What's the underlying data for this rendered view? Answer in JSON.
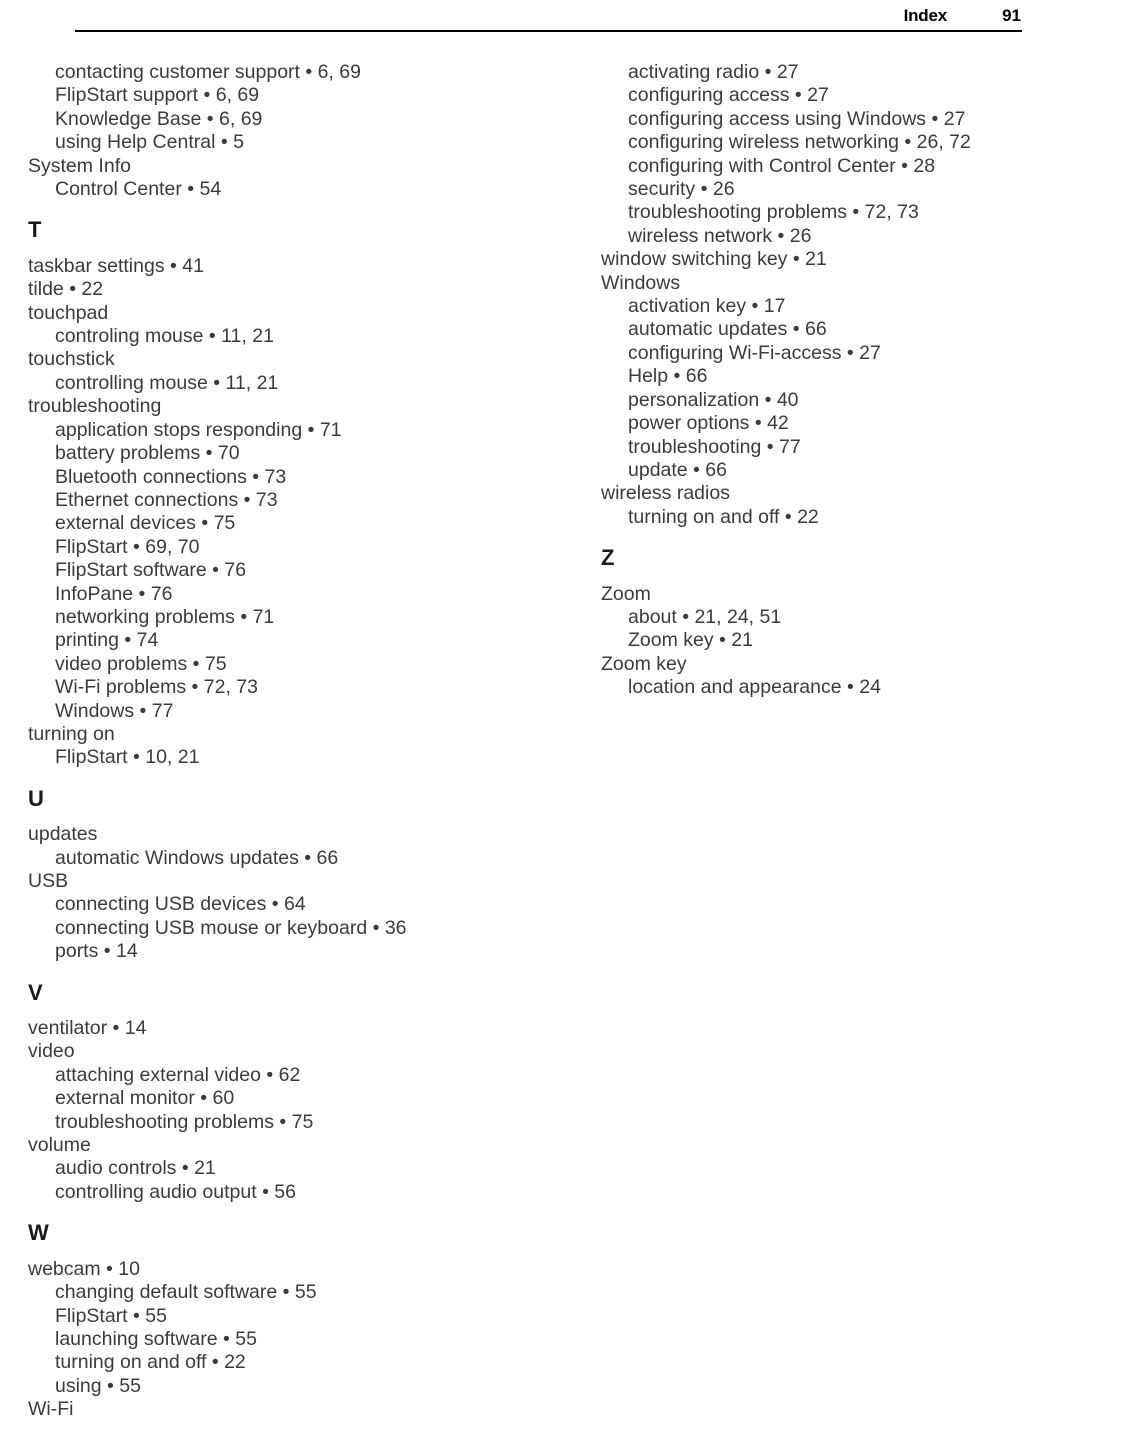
{
  "header": {
    "title": "Index",
    "page_number": "91"
  },
  "columns": [
    {
      "name": "left-column",
      "blocks": [
        {
          "type": "entry",
          "level": 2,
          "text": "contacting customer support • 6, 69"
        },
        {
          "type": "entry",
          "level": 2,
          "text": "FlipStart support • 6, 69"
        },
        {
          "type": "entry",
          "level": 2,
          "text": "Knowledge Base • 6, 69"
        },
        {
          "type": "entry",
          "level": 2,
          "text": "using Help Central • 5"
        },
        {
          "type": "entry",
          "level": 1,
          "text": "System Info"
        },
        {
          "type": "entry",
          "level": 2,
          "text": "Control Center • 54"
        },
        {
          "type": "section",
          "text": "T"
        },
        {
          "type": "entry",
          "level": 1,
          "text": "taskbar settings • 41"
        },
        {
          "type": "entry",
          "level": 1,
          "text": "tilde • 22"
        },
        {
          "type": "entry",
          "level": 1,
          "text": "touchpad"
        },
        {
          "type": "entry",
          "level": 2,
          "text": "controling mouse • 11, 21"
        },
        {
          "type": "entry",
          "level": 1,
          "text": "touchstick"
        },
        {
          "type": "entry",
          "level": 2,
          "text": "controlling mouse • 11, 21"
        },
        {
          "type": "entry",
          "level": 1,
          "text": "troubleshooting"
        },
        {
          "type": "entry",
          "level": 2,
          "text": "application stops responding • 71"
        },
        {
          "type": "entry",
          "level": 2,
          "text": "battery problems • 70"
        },
        {
          "type": "entry",
          "level": 2,
          "text": "Bluetooth connections • 73"
        },
        {
          "type": "entry",
          "level": 2,
          "text": "Ethernet connections • 73"
        },
        {
          "type": "entry",
          "level": 2,
          "text": "external devices • 75"
        },
        {
          "type": "entry",
          "level": 2,
          "text": "FlipStart • 69, 70"
        },
        {
          "type": "entry",
          "level": 2,
          "text": "FlipStart software • 76"
        },
        {
          "type": "entry",
          "level": 2,
          "text": "InfoPane • 76"
        },
        {
          "type": "entry",
          "level": 2,
          "text": "networking problems • 71"
        },
        {
          "type": "entry",
          "level": 2,
          "text": "printing • 74"
        },
        {
          "type": "entry",
          "level": 2,
          "text": "video problems • 75"
        },
        {
          "type": "entry",
          "level": 2,
          "text": "Wi-Fi problems • 72, 73"
        },
        {
          "type": "entry",
          "level": 2,
          "text": "Windows • 77"
        },
        {
          "type": "entry",
          "level": 1,
          "text": "turning on"
        },
        {
          "type": "entry",
          "level": 2,
          "text": "FlipStart • 10, 21"
        },
        {
          "type": "section",
          "text": "U"
        },
        {
          "type": "entry",
          "level": 1,
          "text": "updates"
        },
        {
          "type": "entry",
          "level": 2,
          "text": "automatic Windows updates • 66"
        },
        {
          "type": "entry",
          "level": 1,
          "text": "USB"
        },
        {
          "type": "entry",
          "level": 2,
          "text": "connecting USB devices • 64"
        },
        {
          "type": "entry",
          "level": 2,
          "text": "connecting USB mouse or keyboard • 36"
        },
        {
          "type": "entry",
          "level": 2,
          "text": "ports • 14"
        },
        {
          "type": "section",
          "text": "V"
        },
        {
          "type": "entry",
          "level": 1,
          "text": "ventilator • 14"
        },
        {
          "type": "entry",
          "level": 1,
          "text": "video"
        },
        {
          "type": "entry",
          "level": 2,
          "text": "attaching external video • 62"
        },
        {
          "type": "entry",
          "level": 2,
          "text": "external monitor • 60"
        },
        {
          "type": "entry",
          "level": 2,
          "text": "troubleshooting problems • 75"
        },
        {
          "type": "entry",
          "level": 1,
          "text": "volume"
        },
        {
          "type": "entry",
          "level": 2,
          "text": "audio controls • 21"
        },
        {
          "type": "entry",
          "level": 2,
          "text": "controlling audio output • 56"
        },
        {
          "type": "section",
          "text": "W"
        },
        {
          "type": "entry",
          "level": 1,
          "text": "webcam • 10"
        },
        {
          "type": "entry",
          "level": 2,
          "text": "changing default software • 55"
        },
        {
          "type": "entry",
          "level": 2,
          "text": "FlipStart • 55"
        },
        {
          "type": "entry",
          "level": 2,
          "text": "launching software • 55"
        },
        {
          "type": "entry",
          "level": 2,
          "text": "turning on and off • 22"
        },
        {
          "type": "entry",
          "level": 2,
          "text": "using • 55"
        },
        {
          "type": "entry",
          "level": 1,
          "text": "Wi-Fi"
        }
      ]
    },
    {
      "name": "right-column",
      "blocks": [
        {
          "type": "entry",
          "level": 2,
          "text": "activating radio • 27"
        },
        {
          "type": "entry",
          "level": 2,
          "text": "configuring access • 27"
        },
        {
          "type": "entry",
          "level": 2,
          "text": "configuring access using Windows • 27"
        },
        {
          "type": "entry",
          "level": 2,
          "text": "configuring wireless networking • 26, 72"
        },
        {
          "type": "entry",
          "level": 2,
          "text": "configuring with Control Center • 28"
        },
        {
          "type": "entry",
          "level": 2,
          "text": "security • 26"
        },
        {
          "type": "entry",
          "level": 2,
          "text": "troubleshooting problems • 72, 73"
        },
        {
          "type": "entry",
          "level": 2,
          "text": "wireless network • 26"
        },
        {
          "type": "entry",
          "level": 1,
          "text": "window switching key • 21"
        },
        {
          "type": "entry",
          "level": 1,
          "text": "Windows"
        },
        {
          "type": "entry",
          "level": 2,
          "text": "activation key • 17"
        },
        {
          "type": "entry",
          "level": 2,
          "text": "automatic updates • 66"
        },
        {
          "type": "entry",
          "level": 2,
          "text": "configuring Wi-Fi-access • 27"
        },
        {
          "type": "entry",
          "level": 2,
          "text": "Help • 66"
        },
        {
          "type": "entry",
          "level": 2,
          "text": "personalization • 40"
        },
        {
          "type": "entry",
          "level": 2,
          "text": "power options • 42"
        },
        {
          "type": "entry",
          "level": 2,
          "text": "troubleshooting • 77"
        },
        {
          "type": "entry",
          "level": 2,
          "text": "update • 66"
        },
        {
          "type": "entry",
          "level": 1,
          "text": "wireless radios"
        },
        {
          "type": "entry",
          "level": 2,
          "text": "turning on and off • 22"
        },
        {
          "type": "section",
          "text": "Z"
        },
        {
          "type": "entry",
          "level": 1,
          "text": "Zoom"
        },
        {
          "type": "entry",
          "level": 2,
          "text": "about • 21, 24, 51"
        },
        {
          "type": "entry",
          "level": 2,
          "text": "Zoom key • 21"
        },
        {
          "type": "entry",
          "level": 1,
          "text": "Zoom key"
        },
        {
          "type": "entry",
          "level": 2,
          "text": "location and appearance • 24"
        }
      ]
    }
  ]
}
